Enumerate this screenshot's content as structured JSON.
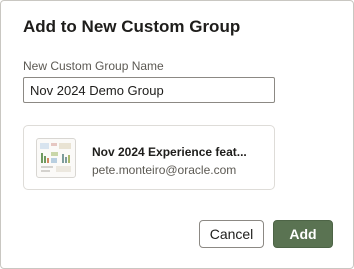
{
  "dialog": {
    "title": "Add to New Custom Group",
    "name_label": "New Custom Group Name",
    "name_value": "Nov 2024 Demo Group"
  },
  "item": {
    "title": "Nov 2024 Experience feat...",
    "owner": "pete.monteiro@oracle.com",
    "thumbnail_icon": "dashboard-thumbnail"
  },
  "buttons": {
    "cancel": "Cancel",
    "add": "Add"
  },
  "colors": {
    "primary": "#5a7352",
    "border": "#c9c7c2"
  }
}
